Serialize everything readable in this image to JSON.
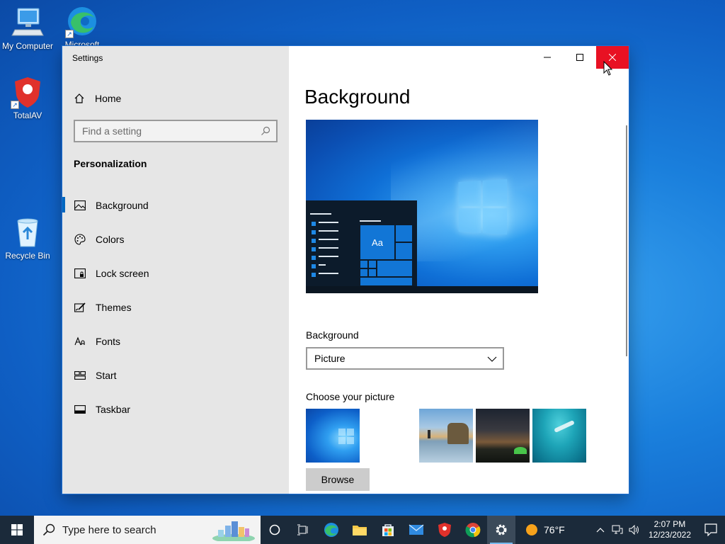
{
  "desktop": {
    "icons": [
      {
        "label": "My Computer"
      },
      {
        "label": "Microsoft Edge"
      },
      {
        "label": "TotalAV"
      },
      {
        "label": "Recycle Bin"
      }
    ]
  },
  "window": {
    "title": "Settings",
    "controls": {
      "minimize": "minimize",
      "maximize": "maximize",
      "close": "close"
    }
  },
  "sidebar": {
    "home_label": "Home",
    "search_placeholder": "Find a setting",
    "section_title": "Personalization",
    "items": [
      {
        "label": "Background",
        "icon": "image-icon",
        "active": true
      },
      {
        "label": "Colors",
        "icon": "palette-icon",
        "active": false
      },
      {
        "label": "Lock screen",
        "icon": "lock-screen-icon",
        "active": false
      },
      {
        "label": "Themes",
        "icon": "themes-icon",
        "active": false
      },
      {
        "label": "Fonts",
        "icon": "fonts-icon",
        "active": false
      },
      {
        "label": "Start",
        "icon": "start-icon",
        "active": false
      },
      {
        "label": "Taskbar",
        "icon": "taskbar-icon",
        "active": false
      }
    ]
  },
  "main": {
    "page_title": "Background",
    "preview": {
      "tile_text": "Aa"
    },
    "background_label": "Background",
    "background_value": "Picture",
    "choose_label": "Choose your picture",
    "browse_label": "Browse"
  },
  "taskbar": {
    "search_placeholder": "Type here to search",
    "weather": "76°F",
    "time": "2:07 PM",
    "date": "12/23/2022"
  },
  "colors": {
    "accent": "#0067c0",
    "close_red": "#e81123",
    "sidebar_bg": "#e6e6e6",
    "taskbar_bg": "#1b2a3a"
  }
}
